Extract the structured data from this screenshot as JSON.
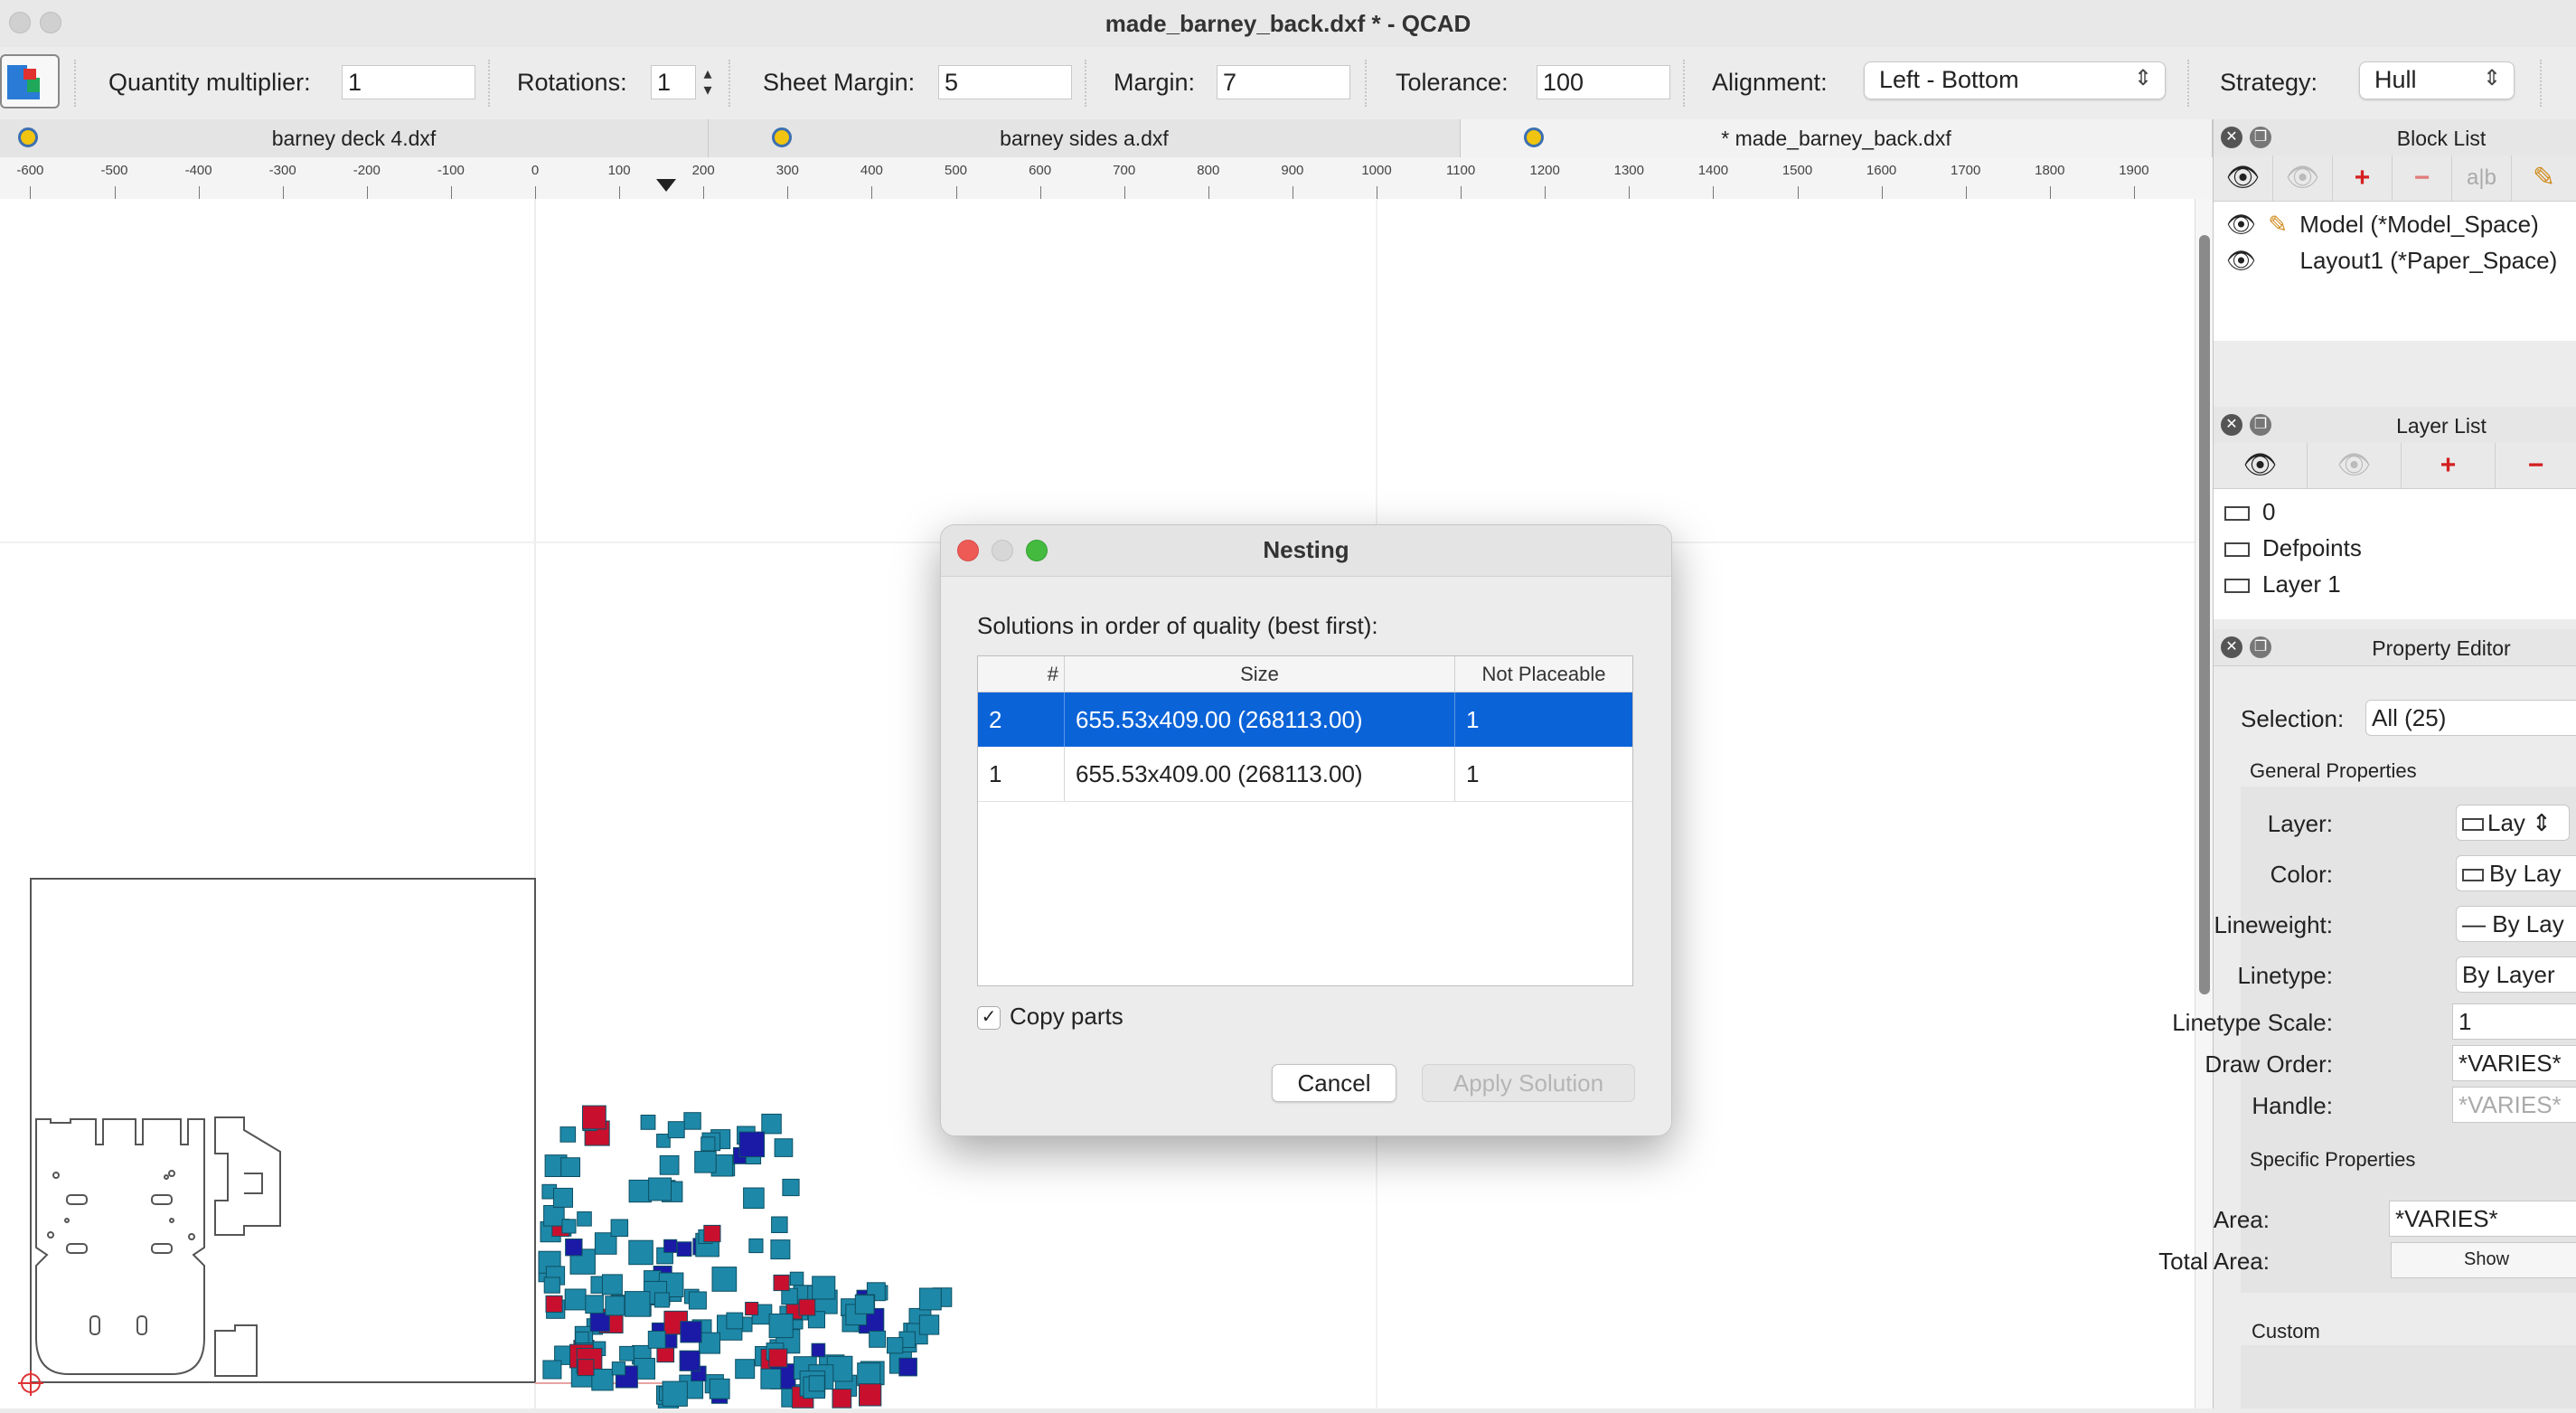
{
  "window": {
    "title": "made_barney_back.dxf * - QCAD"
  },
  "toolbar": {
    "quantity_label": "Quantity multiplier:",
    "quantity_value": "1",
    "rotations_label": "Rotations:",
    "rotations_value": "1",
    "sheet_margin_label": "Sheet Margin:",
    "sheet_margin_value": "5",
    "margin_label": "Margin:",
    "margin_value": "7",
    "tolerance_label": "Tolerance:",
    "tolerance_value": "100",
    "alignment_label": "Alignment:",
    "alignment_value": "Left - Bottom",
    "strategy_label": "Strategy:",
    "strategy_value": "Hull"
  },
  "tabs": [
    {
      "label": "barney deck 4.dxf"
    },
    {
      "label": "barney sides a.dxf"
    },
    {
      "label": "* made_barney_back.dxf"
    }
  ],
  "ruler": {
    "labels": [
      "-600",
      "-500",
      "-400",
      "-300",
      "-200",
      "-100",
      "0",
      "100",
      "200",
      "300",
      "400",
      "500",
      "600",
      "700",
      "800",
      "900",
      "1000",
      "1100",
      "1200",
      "1300",
      "1400",
      "1500",
      "1600",
      "1700",
      "1800",
      "1900"
    ]
  },
  "block_list": {
    "title": "Block List",
    "items": [
      {
        "label": "Model (*Model_Space)"
      },
      {
        "label": "Layout1 (*Paper_Space)"
      }
    ]
  },
  "layer_list": {
    "title": "Layer List",
    "items": [
      {
        "label": "0"
      },
      {
        "label": "Defpoints"
      },
      {
        "label": "Layer 1"
      }
    ]
  },
  "property_editor": {
    "title": "Property Editor",
    "selection_label": "Selection:",
    "selection_value": "All (25)",
    "general_section": "General Properties",
    "layer_label": "Layer:",
    "layer_value": "Lay",
    "color_label": "Color:",
    "color_value": "By Lay",
    "lineweight_label": "Lineweight:",
    "lineweight_value": "By Lay",
    "linetype_label": "Linetype:",
    "linetype_value": "By Layer",
    "linetype_scale_label": "Linetype Scale:",
    "linetype_scale_value": "1",
    "draw_order_label": "Draw Order:",
    "draw_order_value": "*VARIES*",
    "handle_label": "Handle:",
    "handle_value": "*VARIES*",
    "specific_section": "Specific Properties",
    "area_label": "Area:",
    "area_value": "*VARIES*",
    "total_area_label": "Total Area:",
    "total_area_button": "Show",
    "custom_section": "Custom"
  },
  "dialog": {
    "title": "Nesting",
    "heading": "Solutions in order of quality (best first):",
    "columns": [
      "#",
      "Size",
      "Not Placeable"
    ],
    "rows": [
      {
        "num": "2",
        "size": "655.53x409.00 (268113.00)",
        "not_placeable": "1"
      },
      {
        "num": "1",
        "size": "655.53x409.00 (268113.00)",
        "not_placeable": "1"
      }
    ],
    "copy_parts_label": "Copy parts",
    "copy_parts_checked": true,
    "cancel_label": "Cancel",
    "apply_label": "Apply Solution"
  },
  "colors": {
    "part_blue": "#1e88a8",
    "part_navy": "#1a1aa6",
    "part_red": "#c8102e",
    "selection": "#0b63d8"
  }
}
